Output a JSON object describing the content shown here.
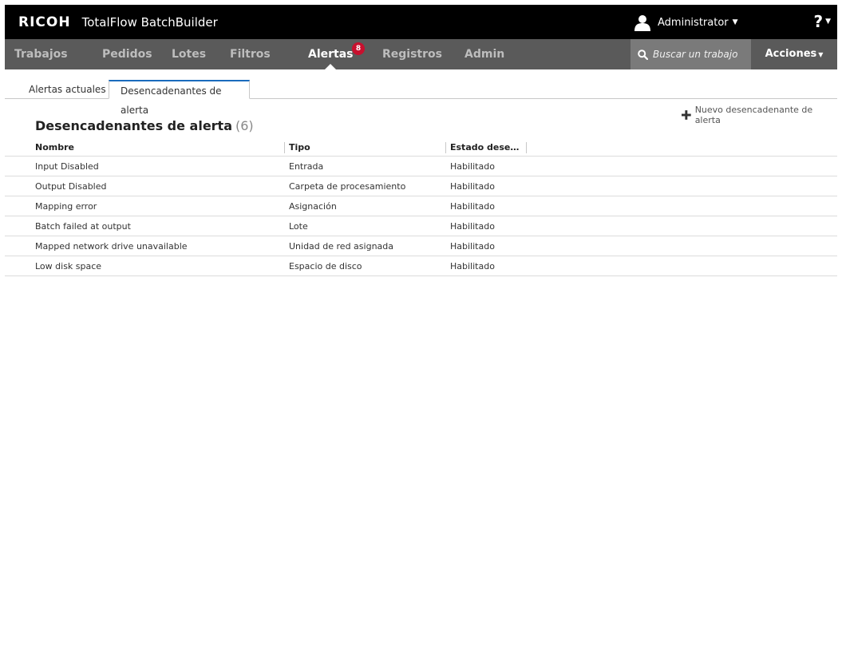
{
  "header": {
    "brand": "RICOH",
    "product": "TotalFlow BatchBuilder",
    "user": "Administrator",
    "help": "?"
  },
  "nav": {
    "items": [
      {
        "label": "Trabajos"
      },
      {
        "label": "Pedidos"
      },
      {
        "label": "Lotes"
      },
      {
        "label": "Filtros"
      },
      {
        "label": "Alertas",
        "badge": "8",
        "active": true
      },
      {
        "label": "Registros"
      },
      {
        "label": "Admin"
      }
    ],
    "search_placeholder": "Buscar un trabajo",
    "actions_label": "Acciones"
  },
  "tabs": [
    {
      "label": "Alertas actuales"
    },
    {
      "label": "Desencadenantes de alerta",
      "active": true
    }
  ],
  "main": {
    "new_trigger_label": "Nuevo desencadenante de alerta",
    "title": "Desencadenantes de alerta",
    "count": "(6)",
    "columns": [
      "Nombre",
      "Tipo",
      "Estado dese…"
    ],
    "rows": [
      {
        "name": "Input Disabled",
        "type": "Entrada",
        "state": "Habilitado"
      },
      {
        "name": "Output Disabled",
        "type": "Carpeta de procesamiento",
        "state": "Habilitado"
      },
      {
        "name": "Mapping error",
        "type": "Asignación",
        "state": "Habilitado"
      },
      {
        "name": "Batch failed at output",
        "type": "Lote",
        "state": "Habilitado"
      },
      {
        "name": "Mapped network drive unavailable",
        "type": "Unidad de red asignada",
        "state": "Habilitado"
      },
      {
        "name": "Low disk space",
        "type": "Espacio de disco",
        "state": "Habilitado"
      }
    ]
  },
  "colors": {
    "topbar": "#000000",
    "navbar": "#5a5a5a",
    "search_bg": "#7a7a7a",
    "badge": "#c8102e",
    "active_tab_accent": "#1a6bbd"
  }
}
